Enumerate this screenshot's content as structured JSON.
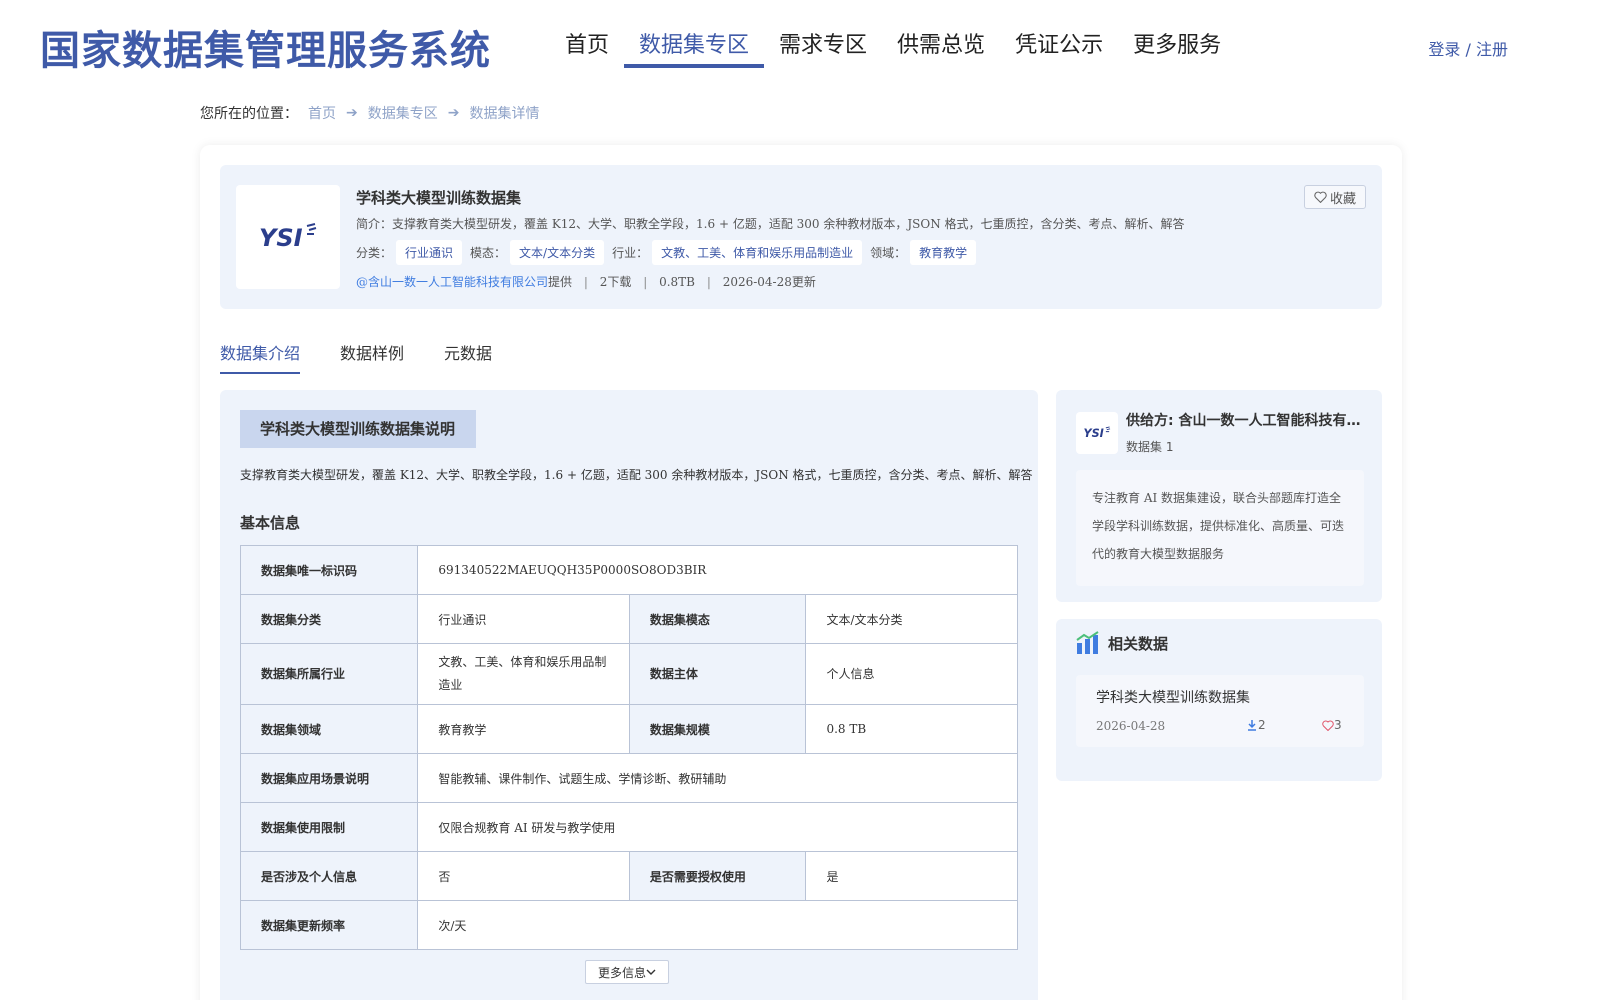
{
  "header": {
    "site_title": "国家数据集管理服务系统",
    "nav": [
      "首页",
      "数据集专区",
      "需求专区",
      "供需总览",
      "凭证公示",
      "更多服务"
    ],
    "active_nav": "数据集专区",
    "login": "登录 / 注册"
  },
  "breadcrumb": {
    "label": "您所在的位置：",
    "items": [
      "首页",
      "数据集专区",
      "数据集详情"
    ]
  },
  "dataset": {
    "title": "学科类大模型训练数据集",
    "description": "简介：支撑教育类大模型研发，覆盖 K12、大学、职教全学段，1.6 + 亿题，适配 300 余种教材版本，JSON 格式，七重质控，含分类、考点、解析、解答",
    "category_label": "分类：",
    "category": "行业通识",
    "modality_label": "模态：",
    "modality": "文本/文本分类",
    "industry_label": "行业：",
    "industry": "文教、工美、体育和娱乐用品制造业",
    "domain_label": "领域：",
    "domain": "教育教学",
    "provider": "@含山一数一人工智能科技有限公司",
    "provider_suffix": "提供",
    "downloads": "2下载",
    "size": "0.8TB",
    "updated": "2026-04-28更新",
    "fav_label": "收藏",
    "logo_text": "YSI"
  },
  "tabs": [
    "数据集介绍",
    "数据样例",
    "元数据"
  ],
  "intro": {
    "section_title": "学科类大模型训练数据集说明",
    "section_desc": "支撑教育类大模型研发，覆盖 K12、大学、职教全学段，1.6 + 亿题，适配 300 余种教材版本，JSON 格式，七重质控，含分类、考点、解析、解答",
    "basic_title": "基本信息",
    "table": {
      "id_label": "数据集唯一标识码",
      "id_value": "691340522MAEUQQH35P0000SO8OD3BIR",
      "category_label": "数据集分类",
      "category_value": "行业通识",
      "modality_label": "数据集模态",
      "modality_value": "文本/文本分类",
      "industry_label": "数据集所属行业",
      "industry_value": "文教、工美、体育和娱乐用品制造业",
      "subject_label": "数据主体",
      "subject_value": "个人信息",
      "domain_label": "数据集领域",
      "domain_value": "教育教学",
      "scale_label": "数据集规模",
      "scale_value": "0.8 TB",
      "scenario_label": "数据集应用场景说明",
      "scenario_value": "智能教辅、课件制作、试题生成、学情诊断、教研辅助",
      "limit_label": "数据集使用限制",
      "limit_value": "仅限合规教育 AI 研发与教学使用",
      "personal_label": "是否涉及个人信息",
      "personal_value": "否",
      "auth_label": "是否需要授权使用",
      "auth_value": "是",
      "freq_label": "数据集更新频率",
      "freq_value": "次/天"
    },
    "more_label": "更多信息"
  },
  "provider_card": {
    "name": "供给方: 含山一数一人工智能科技有限公司",
    "count": "数据集 1",
    "description": "专注教育 AI 数据集建设，联合头部题库打造全学段学科训练数据，提供标准化、高质量、可迭代的教育大模型数据服务"
  },
  "related": {
    "title": "相关数据",
    "items": [
      {
        "title": "学科类大模型训练数据集",
        "date": "2026-04-28",
        "downloads": "2",
        "likes": "3"
      }
    ]
  },
  "colors": {
    "brand": "#3f5aa8",
    "panel_bg": "#eef3fb",
    "link": "#3f7ce0"
  }
}
